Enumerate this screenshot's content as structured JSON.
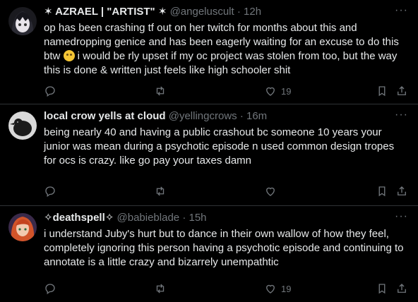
{
  "tweets": [
    {
      "name": "✶ AZRAEL | \"ARTIST\" ✶",
      "handle": "@angeluscult",
      "sep": "·",
      "time": "12h",
      "text_before": "op has been crashing tf out on her twitch for months about this and namedropping genice and has been eagerly waiting for an excuse to do this btw ",
      "emoji": "slightly-smiling-face",
      "text_after": " i would be rly upset if my oc project was stolen from too, but the way this is done & written just feels like high schooler shit",
      "likes": "19"
    },
    {
      "name": "local crow yells at cloud",
      "handle": "@yellingcrows",
      "sep": "·",
      "time": "16m",
      "text_before": "being nearly 40 and having a public crashout bc someone 10 years your junior was mean during a psychotic episode n used common design tropes for ocs is crazy. like go pay your taxes damn",
      "likes": ""
    },
    {
      "name": "✧deathspell✧",
      "handle": "@babieblade",
      "sep": "·",
      "time": "15h",
      "text_before": "i understand Juby's hurt but to dance in their own wallow of how they feel, completely ignoring this person having a psychotic episode and continuing to annotate is a little crazy and bizarrely unempathtic",
      "likes": "19"
    }
  ],
  "ui": {
    "more_label": "···"
  },
  "colors": {
    "background": "#000000",
    "text": "#e7e9ea",
    "muted": "#71767b",
    "divider": "#2f3336"
  }
}
